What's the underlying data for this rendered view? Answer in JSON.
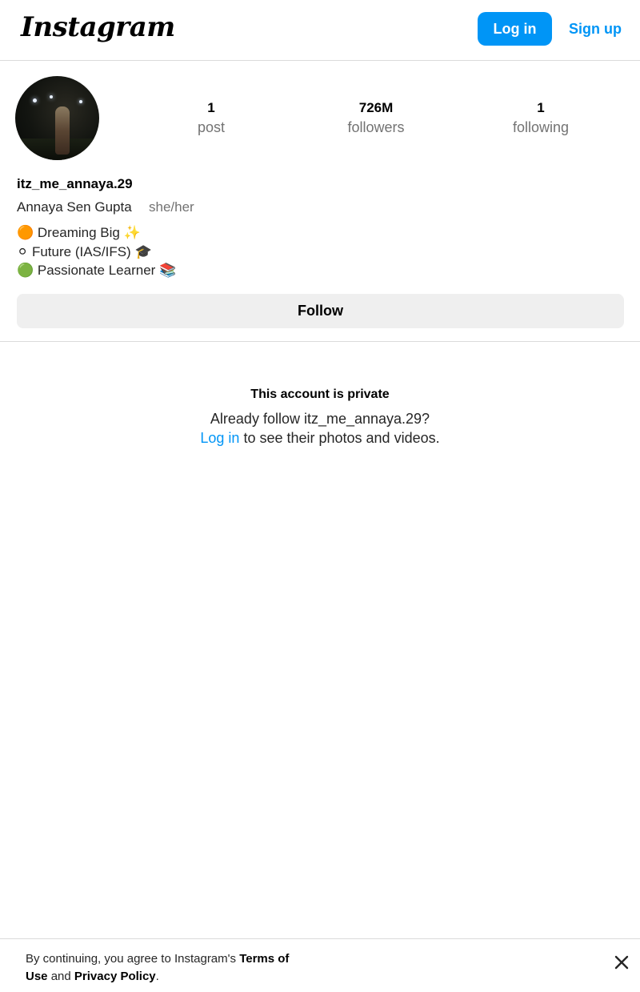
{
  "header": {
    "logo": "Instagram",
    "login_label": "Log in",
    "signup_label": "Sign up"
  },
  "profile": {
    "stats": {
      "posts_count": "1",
      "posts_label": "post",
      "followers_count": "726M",
      "followers_label": "followers",
      "following_count": "1",
      "following_label": "following"
    },
    "username": "itz_me_annaya.29",
    "full_name": "Annaya Sen Gupta",
    "pronouns": "she/her",
    "bio_lines": [
      "🟠 Dreaming Big ✨",
      "⚪ Future (IAS/IFS) 🎓",
      "🟢 Passionate Learner 📚"
    ],
    "follow_label": "Follow"
  },
  "private": {
    "title": "This account is private",
    "prefix": "Already follow itz_me_annaya.29?",
    "login_link": "Log in",
    "suffix": "to see their photos and videos."
  },
  "footer": {
    "text_prefix": "By continuing, you agree to Instagram's",
    "terms_link": "Terms of Use",
    "and": "and",
    "privacy_link": "Privacy Policy",
    "period": "."
  },
  "colors": {
    "accent": "#0095f6",
    "secondary_text": "#737373",
    "button_bg": "#efefef",
    "divider": "#dbdbdb"
  },
  "icons": {
    "close": "close-icon"
  }
}
